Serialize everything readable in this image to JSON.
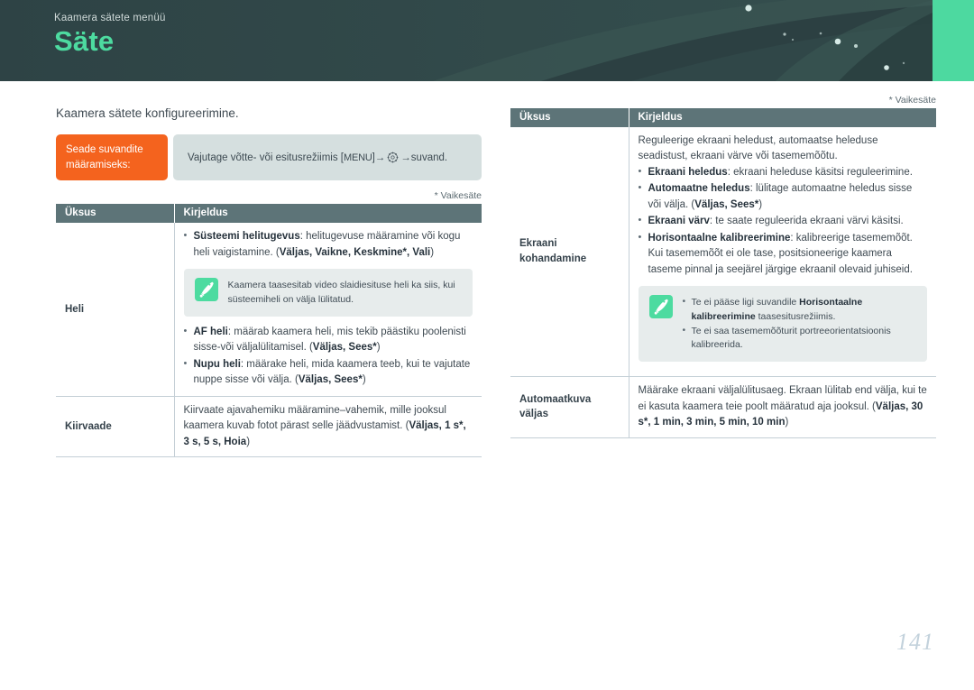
{
  "banner": {
    "subtitle": "Kaamera sätete menüü",
    "title": "Säte",
    "accent_color": "#4dd9a0",
    "bg_color": "#2f4446"
  },
  "intro": "Kaamera sätete konfigureerimine.",
  "howto": {
    "label": "Seade suvandite määramiseks:",
    "text_before": "Vajutage võtte- või esitusrežiimis [",
    "key": "MENU",
    "text_mid": "] ",
    "arrow": "→",
    "gear_icon": "gear-icon",
    "text_after": " suvand."
  },
  "default_note": "* Vaikesäte",
  "table_headers": {
    "item": "Üksus",
    "description": "Kirjeldus"
  },
  "left_table": {
    "rows": [
      {
        "item": "Heli",
        "bullets_top": [
          {
            "bold": "Süsteemi helitugevus",
            "rest": ": helitugevuse määramine või kogu heli vaigistamine. (",
            "options": "Väljas, Vaikne, Keskmine*, Vali",
            "tail": ")"
          }
        ],
        "tip": {
          "icon": "note-pen-icon",
          "lines": [
            "Kaamera taasesitab video slaidiesituse heli ka siis, kui süsteemiheli on välja lülitatud."
          ]
        },
        "bullets_bottom": [
          {
            "bold": "AF heli",
            "rest": ": määrab kaamera heli, mis tekib päästiku poolenisti sisse-või väljalülitamisel. (",
            "options": "Väljas, Sees*",
            "tail": ")"
          },
          {
            "bold": "Nupu heli",
            "rest": ": määrake heli, mida kaamera teeb, kui te vajutate nuppe sisse või välja. (",
            "options": "Väljas, Sees*",
            "tail": ")"
          }
        ]
      },
      {
        "item": "Kiirvaade",
        "plain_before": "Kiirvaate ajavahemiku määramine–vahemik, mille jooksul kaamera kuvab fotot pärast selle jäädvustamist. (",
        "plain_options": "Väljas, 1 s*, 3 s, 5 s, Hoia",
        "plain_tail": ")"
      }
    ]
  },
  "right_table": {
    "rows": [
      {
        "item": "Ekraani kohandamine",
        "lead": "Reguleerige ekraani heledust, automaatse heleduse seadistust, ekraani värve või tasememõõtu.",
        "bullets_top": [
          {
            "bold": "Ekraani heledus",
            "rest": ": ekraani heleduse käsitsi reguleerimine.",
            "options": "",
            "tail": ""
          },
          {
            "bold": "Automaatne heledus",
            "rest": ": lülitage automaatne heledus sisse või välja. (",
            "options": "Väljas, Sees*",
            "tail": ")"
          },
          {
            "bold": "Ekraani värv",
            "rest": ": te saate reguleerida ekraani värvi käsitsi.",
            "options": "",
            "tail": ""
          },
          {
            "bold": "Horisontaalne kalibreerimine",
            "rest": ": kalibreerige tasememõõt. Kui tasememõõt ei ole tase, positsioneerige kaamera taseme pinnal ja seejärel järgige ekraanil olevaid juhiseid.",
            "options": "",
            "tail": ""
          }
        ],
        "tip": {
          "icon": "note-pen-icon",
          "bullets": [
            {
              "pre": "Te ei pääse ligi suvandile ",
              "bold": "Horisontaalne kalibreerimine",
              "post": " taasesitusrežiimis."
            },
            {
              "pre": "Te ei saa tasememõõturit portreeorientatsioonis kalibreerida.",
              "bold": "",
              "post": ""
            }
          ]
        }
      },
      {
        "item": "Automaatkuva väljas",
        "plain_before": "Määrake ekraani väljalülitusaeg. Ekraan lülitab end välja, kui te ei kasuta kaamera teie poolt määratud aja jooksul. (",
        "plain_options": "Väljas, 30 s*, 1 min, 3 min, 5 min, 10 min",
        "plain_tail": ")"
      }
    ]
  },
  "page_number": "141"
}
